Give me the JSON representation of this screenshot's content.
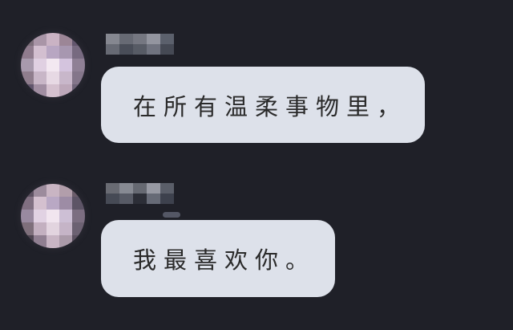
{
  "messages": [
    {
      "text": "在所有温柔事物里，",
      "avatar_colors": [
        "#7b6d79",
        "#a995a7",
        "#cab3c4",
        "#9c8697",
        "#62566d",
        "#8f7b8d",
        "#d3bfd0",
        "#b8a6c2",
        "#a797b0",
        "#776a80",
        "#a89aad",
        "#e0d0e2",
        "#f3e8f1",
        "#d4c4de",
        "#8f8095",
        "#8f7d8d",
        "#c8b6c7",
        "#e7d9e4",
        "#c8b7ca",
        "#84768a",
        "#61556c",
        "#a18ea2",
        "#d5c1cf",
        "#bda8ba",
        "#6f6478"
      ],
      "name_colors": [
        "#8b8d96",
        "#6b6f79",
        "#7a7c86",
        "#9a9ca6",
        "#5f6470",
        "#6b6f79",
        "#4c505b",
        "#5b5f69",
        "#757884",
        "#484c57"
      ]
    },
    {
      "text": "我最喜欢你。",
      "avatar_colors": [
        "#5b5060",
        "#9c8b9c",
        "#c9b5c3",
        "#b29eab",
        "#6b5d6b",
        "#806f81",
        "#d4c0cf",
        "#b9a8c4",
        "#9d8ca5",
        "#5d5466",
        "#998aa0",
        "#e1d2e3",
        "#f1e5ef",
        "#cdbfd5",
        "#7c6e81",
        "#7e6f7b",
        "#c3b0c0",
        "#e2d4df",
        "#c5b4c7",
        "#6c6172",
        "#4d4450",
        "#907f91",
        "#c8b5c4",
        "#aa9aa9",
        "#5b5060"
      ],
      "name_colors": [
        "#6d7078",
        "#8d9099",
        "#6a6d76",
        "#9ea0aa",
        "#5e626d",
        "#494d58",
        "#5a5e69",
        "#2d2f38",
        "#6a6e7b",
        "#3f4350"
      ]
    }
  ]
}
